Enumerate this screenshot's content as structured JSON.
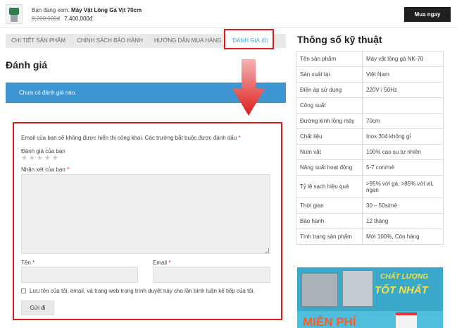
{
  "topbar": {
    "viewing_prefix": "Bạn đang xem: ",
    "product_name": "Máy Vặt Lông Gà Vịt 70cm",
    "old_price": "8,200,000đ",
    "new_price": "7,400,000đ",
    "buy_label": "Mua ngay"
  },
  "tabs": [
    {
      "label": "CHI TIẾT SẢN PHẨM"
    },
    {
      "label": "CHÍNH SÁCH BẢO HÀNH"
    },
    {
      "label": "HƯỚNG DẪN MUA HÀNG"
    },
    {
      "label": "ĐÁNH GIÁ (0)",
      "active": true
    }
  ],
  "reviews": {
    "title": "Đánh giá",
    "empty_message": "Chưa có đánh giá nào."
  },
  "form": {
    "notice": "Email của bạn sẽ không được hiển thị công khai. Các trường bắt buộc được đánh dấu",
    "required_mark": "*",
    "rating_label": "Đánh giá của bạn",
    "comment_label": "Nhận xét của bạn",
    "name_label": "Tên",
    "email_label": "Email",
    "save_label": "Lưu tên của tôi, email, và trang web trong trình duyệt này cho lần bình luận kế tiếp của tôi.",
    "submit_label": "Gửi đi",
    "star_count": 5
  },
  "specs": {
    "title": "Thông số kỹ thuật",
    "rows": [
      {
        "key": "Tên sản phẩm",
        "value": "Máy vặt lông gà NK-70"
      },
      {
        "key": "Sản xuất tại",
        "value": "Việt Nam"
      },
      {
        "key": "Điện áp sử dụng",
        "value": "220V / 50Hz"
      },
      {
        "key": "Công suất",
        "value": ""
      },
      {
        "key": "Đường kính lồng máy",
        "value": "70cm"
      },
      {
        "key": "Chất liệu",
        "value": "Inox 304 không gỉ"
      },
      {
        "key": "Núm vặt",
        "value": "100% cao su tự nhiên"
      },
      {
        "key": "Năng suất hoạt động",
        "value": "5-7 con/mẻ"
      },
      {
        "key": "Tỷ lệ sạch hiệu quả",
        "value": ">95% với gà, >85% với vịt, ngan"
      },
      {
        "key": "Thời gian",
        "value": "30 – 50s/mẻ"
      },
      {
        "key": "Bảo hành",
        "value": "12 tháng"
      },
      {
        "key": "Tình trạng sản phẩm",
        "value": "Mới 100%, Còn hàng"
      }
    ]
  },
  "banner": {
    "line1": "CHẤT LƯỢNG",
    "line2": "TỐT NHẤT",
    "line3": "MIỄN PHÍ"
  },
  "colors": {
    "accent_blue": "#3d96d1",
    "highlight_red": "#e01b1b",
    "active_tab": "#3fa7d6",
    "buy_button": "#1f1f1f"
  }
}
